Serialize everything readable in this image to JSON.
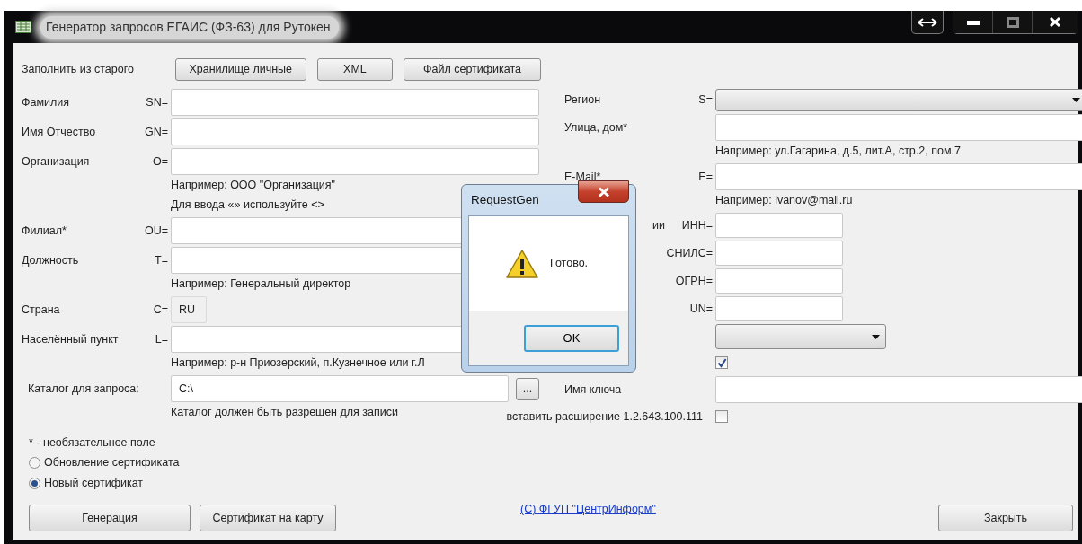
{
  "window": {
    "title": "Генератор запросов ЕГАИС (ФЗ-63) для Рутокен"
  },
  "fill_from_old": {
    "label": "Заполнить из старого",
    "buttons": [
      "Хранилище личные",
      "XML",
      "Файл сертификата"
    ]
  },
  "left_fields": [
    {
      "kind": "input",
      "label": "Фамилия",
      "prefix": "SN="
    },
    {
      "kind": "input",
      "label": "Имя Отчество",
      "prefix": "GN="
    },
    {
      "kind": "input",
      "label": "Организация",
      "prefix": "O=",
      "hints": [
        "Например: ООО \"Организация\"",
        "Для ввода «» используйте <>"
      ]
    },
    {
      "kind": "input",
      "label": "Филиал*",
      "prefix": "OU="
    },
    {
      "kind": "input",
      "label": "Должность",
      "prefix": "T=",
      "hints": [
        "Например: Генеральный директор"
      ]
    },
    {
      "kind": "readonly",
      "label": "Страна",
      "prefix": "C=",
      "value": "RU"
    },
    {
      "kind": "input",
      "label": "Населённый пункт",
      "prefix": "L=",
      "hints": [
        "Например: р-н Приозерский, п.Кузнечное или г.Л"
      ]
    },
    {
      "kind": "browse",
      "label": "Каталог для запроса:",
      "value": "C:\\",
      "button": "...",
      "hints": [
        "Каталог должен быть разрешен для записи"
      ]
    }
  ],
  "right_fields": [
    {
      "kind": "select",
      "label": "Регион",
      "prefix": "S="
    },
    {
      "kind": "input",
      "label": "Улица, дом*",
      "hint": "Например: ул.Гагарина, д.5, лит.А, стр.2, пом.7"
    },
    {
      "kind": "input",
      "label": "E-Mail*",
      "prefix": "E=",
      "hint": "Например: ivanov@mail.ru"
    },
    {
      "kind": "short",
      "label": "ии",
      "prefix": "ИНН="
    },
    {
      "kind": "short",
      "prefix": "СНИЛС="
    },
    {
      "kind": "short",
      "prefix": "ОГРН="
    },
    {
      "kind": "short",
      "prefix": "UN="
    },
    {
      "kind": "short_select"
    },
    {
      "kind": "checkbox",
      "checked": true
    },
    {
      "kind": "input",
      "label": "Имя ключа"
    },
    {
      "kind": "checkbox",
      "label": "вставить расширение 1.2.643.100.111",
      "checked": false
    }
  ],
  "note": "* - необязательное поле",
  "radios": [
    {
      "label": "Обновление сертификата",
      "selected": false
    },
    {
      "label": "Новый сертификат",
      "selected": true
    }
  ],
  "buttons": [
    "Генерация",
    "Сертификат на карту"
  ],
  "link": "(C) ФГУП \"ЦентрИнформ\"",
  "close_button": "Закрыть",
  "dialog": {
    "title": "RequestGen",
    "message": "Готово.",
    "ok": "OK"
  }
}
